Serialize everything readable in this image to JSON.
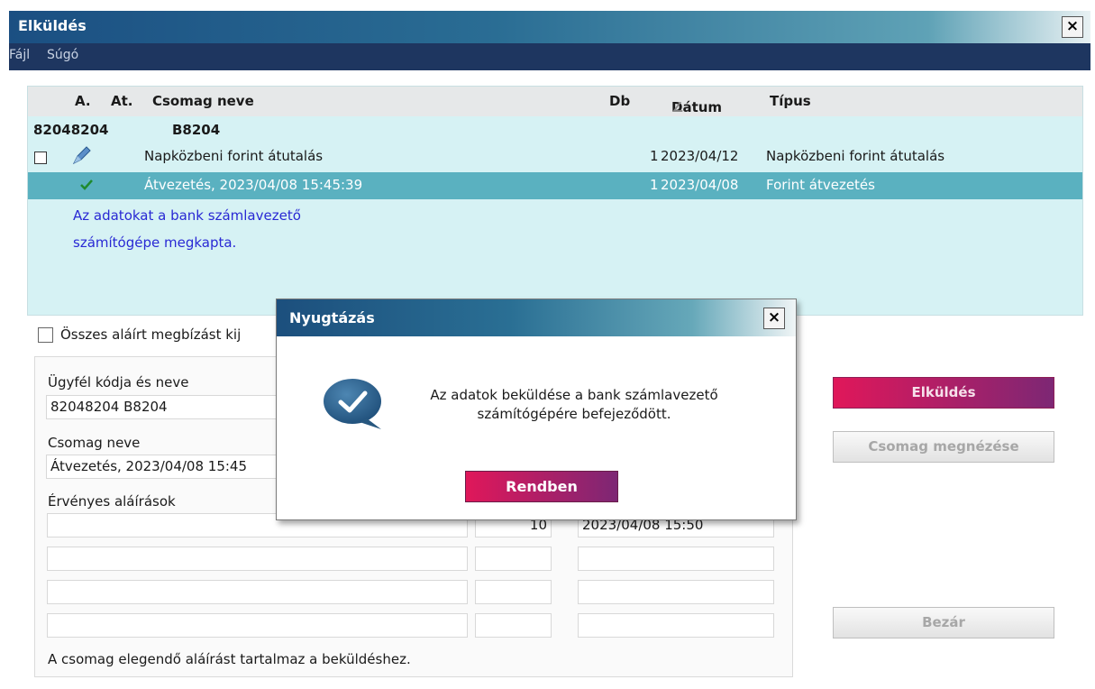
{
  "window": {
    "title": "Elküldés",
    "close_label": "×"
  },
  "menu": {
    "items": [
      "Fájl",
      "Súgó"
    ]
  },
  "package_list": {
    "columns": [
      "A.",
      "At.",
      "Csomag neve",
      "Db",
      "Dátum",
      "Típus"
    ],
    "sort_indicator": "∠",
    "group": {
      "code": "82048204",
      "name": "B8204"
    },
    "rows": [
      {
        "name": "Napközbeni forint átutalás",
        "db": "1",
        "date": "2023/04/12",
        "type": "Napközbeni forint átutalás",
        "icon": "pen-icon",
        "selected": false
      },
      {
        "name": "Átvezetés, 2023/04/08 15:45:39",
        "db": "1",
        "date": "2023/04/08",
        "type": "Forint átvezetés",
        "icon": "checkmark-icon",
        "selected": true
      }
    ],
    "status_message_line1": "Az adatokat a bank számlavezető",
    "status_message_line2": "számítógépe megkapta."
  },
  "all_signed_checkbox_label": "Összes aláírt megbízást kij",
  "details": {
    "client_label": "Ügyfél kódja és neve",
    "client_value": "82048204  B8204",
    "package_label": "Csomag neve",
    "package_value": "Átvezetés, 2023/04/08 15:45",
    "signatures_label": "Érvényes aláírások",
    "signatures": [
      {
        "name": "",
        "count": "10",
        "time": "2023/04/08 15:50"
      },
      {
        "name": "",
        "count": "",
        "time": ""
      },
      {
        "name": "",
        "count": "",
        "time": ""
      },
      {
        "name": "",
        "count": "",
        "time": ""
      }
    ],
    "note": "A csomag elegendő aláírást tartalmaz a beküldéshez."
  },
  "buttons": {
    "send": "Elküldés",
    "view_package": "Csomag megnézése",
    "close": "Bezár"
  },
  "dialog": {
    "title": "Nyugtázás",
    "close_label": "×",
    "message_line1": "Az adatok beküldése a bank számlavezető",
    "message_line2": "számítógépére befejeződött.",
    "ok_button": "Rendben",
    "icon": "check-speech-bubble-icon"
  },
  "colors": {
    "accent_start": "#e0175a",
    "accent_end": "#7d2774",
    "list_bg": "#d6f2f4",
    "selected_row": "#5ab1c0",
    "status_text": "#2929d4"
  }
}
